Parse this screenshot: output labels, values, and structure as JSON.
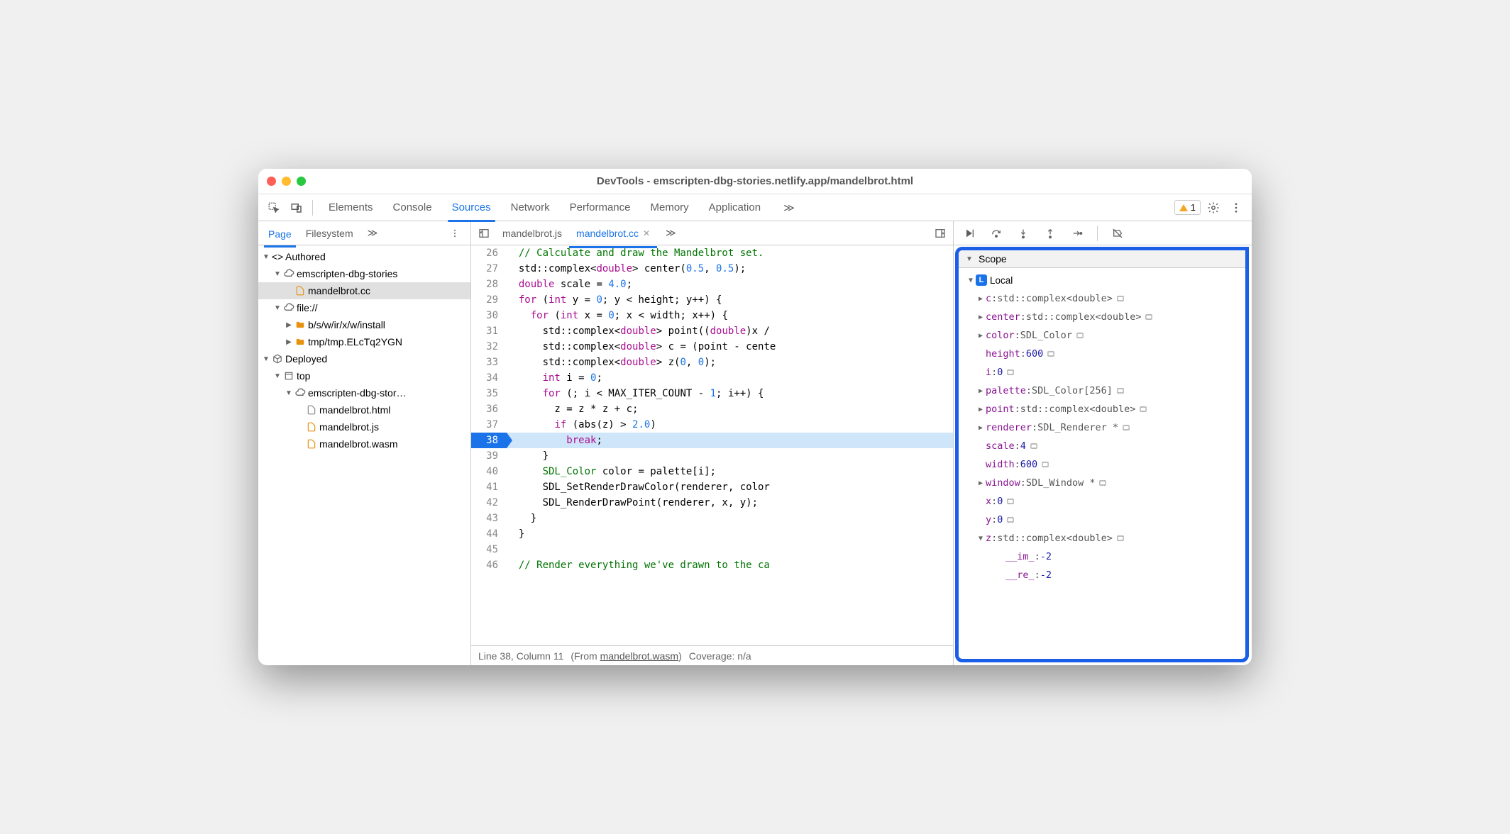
{
  "title": "DevTools - emscripten-dbg-stories.netlify.app/mandelbrot.html",
  "tabs": [
    "Elements",
    "Console",
    "Sources",
    "Network",
    "Performance",
    "Memory",
    "Application"
  ],
  "active_tab": "Sources",
  "warning_count": "1",
  "sidebar": {
    "tabs": [
      "Page",
      "Filesystem"
    ],
    "active": "Page",
    "tree": {
      "authored": "Authored",
      "domain1": "emscripten-dbg-stories",
      "file_cc": "mandelbrot.cc",
      "file_scheme": "file://",
      "folder1": "b/s/w/ir/x/w/install",
      "folder2": "tmp/tmp.ELcTq2YGN",
      "deployed": "Deployed",
      "top": "top",
      "domain2": "emscripten-dbg-stor…",
      "file_html": "mandelbrot.html",
      "file_js": "mandelbrot.js",
      "file_wasm": "mandelbrot.wasm"
    }
  },
  "editor": {
    "tabs": [
      {
        "label": "mandelbrot.js",
        "active": false
      },
      {
        "label": "mandelbrot.cc",
        "active": true
      }
    ],
    "code": [
      {
        "n": "26",
        "t": "  // Calculate and draw the Mandelbrot set.",
        "cls": "cm"
      },
      {
        "n": "27",
        "html": "  std::complex&lt;<span class='kw'>double</span>&gt; center(<span class='num'>0.5</span>, <span class='num'>0.5</span>);"
      },
      {
        "n": "28",
        "html": "  <span class='kw'>double</span> scale = <span class='num'>4.0</span>;"
      },
      {
        "n": "29",
        "html": "  <span class='kw'>for</span> (<span class='kw'>int</span> y = <span class='num'>0</span>; y &lt; height; y++) {"
      },
      {
        "n": "30",
        "html": "    <span class='kw'>for</span> (<span class='kw'>int</span> x = <span class='num'>0</span>; x &lt; width; x++) {"
      },
      {
        "n": "31",
        "html": "      std::complex&lt;<span class='kw'>double</span>&gt; point((<span class='kw'>double</span>)x /"
      },
      {
        "n": "32",
        "html": "      std::complex&lt;<span class='kw'>double</span>&gt; c = (point - cente"
      },
      {
        "n": "33",
        "html": "      std::complex&lt;<span class='kw'>double</span>&gt; z(<span class='num'>0</span>, <span class='num'>0</span>);"
      },
      {
        "n": "34",
        "html": "      <span class='kw'>int</span> i = <span class='num'>0</span>;"
      },
      {
        "n": "35",
        "html": "      <span class='kw'>for</span> (; i &lt; MAX_ITER_COUNT - <span class='num'>1</span>; i++) {"
      },
      {
        "n": "36",
        "html": "        z = z * z + c;"
      },
      {
        "n": "37",
        "html": "        <span class='kw'>if</span> (abs(z) &gt; <span class='num'>2.0</span>)"
      },
      {
        "n": "38",
        "html": "          <span class='kw'>break</span>;",
        "bp": true
      },
      {
        "n": "39",
        "html": "      }"
      },
      {
        "n": "40",
        "html": "      <span class='ty'>SDL_Color</span> color = palette[i];"
      },
      {
        "n": "41",
        "html": "      SDL_SetRenderDrawColor(renderer, color"
      },
      {
        "n": "42",
        "html": "      SDL_RenderDrawPoint(renderer, x, y);"
      },
      {
        "n": "43",
        "html": "    }"
      },
      {
        "n": "44",
        "html": "  }"
      },
      {
        "n": "45",
        "html": ""
      },
      {
        "n": "46",
        "html": "  <span class='cm'>// Render everything we've drawn to the ca</span>"
      }
    ],
    "status": {
      "line": "Line 38, Column 11",
      "from": "(From ",
      "wasm": "mandelbrot.wasm",
      "close": ") ",
      "coverage": "Coverage: n/a"
    }
  },
  "scope": {
    "header": "Scope",
    "local_label": "Local",
    "vars": [
      {
        "k": "c",
        "v": "std::complex<double>",
        "exp": true,
        "mem": true
      },
      {
        "k": "center",
        "v": "std::complex<double>",
        "exp": true,
        "mem": true
      },
      {
        "k": "color",
        "v": "SDL_Color",
        "exp": true,
        "mem": true
      },
      {
        "k": "height",
        "v": "600",
        "num": true,
        "mem": true
      },
      {
        "k": "i",
        "v": "0",
        "num": true,
        "mem": true
      },
      {
        "k": "palette",
        "v": "SDL_Color[256]",
        "exp": true,
        "mem": true
      },
      {
        "k": "point",
        "v": "std::complex<double>",
        "exp": true,
        "mem": true
      },
      {
        "k": "renderer",
        "v": "SDL_Renderer *",
        "exp": true,
        "mem": true
      },
      {
        "k": "scale",
        "v": "4",
        "num": true,
        "mem": true
      },
      {
        "k": "width",
        "v": "600",
        "num": true,
        "mem": true
      },
      {
        "k": "window",
        "v": "SDL_Window *",
        "exp": true,
        "mem": true
      },
      {
        "k": "x",
        "v": "0",
        "num": true,
        "mem": true
      },
      {
        "k": "y",
        "v": "0",
        "num": true,
        "mem": true
      },
      {
        "k": "z",
        "v": "std::complex<double>",
        "exp": true,
        "open": true,
        "mem": true
      },
      {
        "k": "__im_",
        "v": "-2",
        "num": true,
        "child": true
      },
      {
        "k": "__re_",
        "v": "-2",
        "num": true,
        "child": true
      }
    ]
  }
}
